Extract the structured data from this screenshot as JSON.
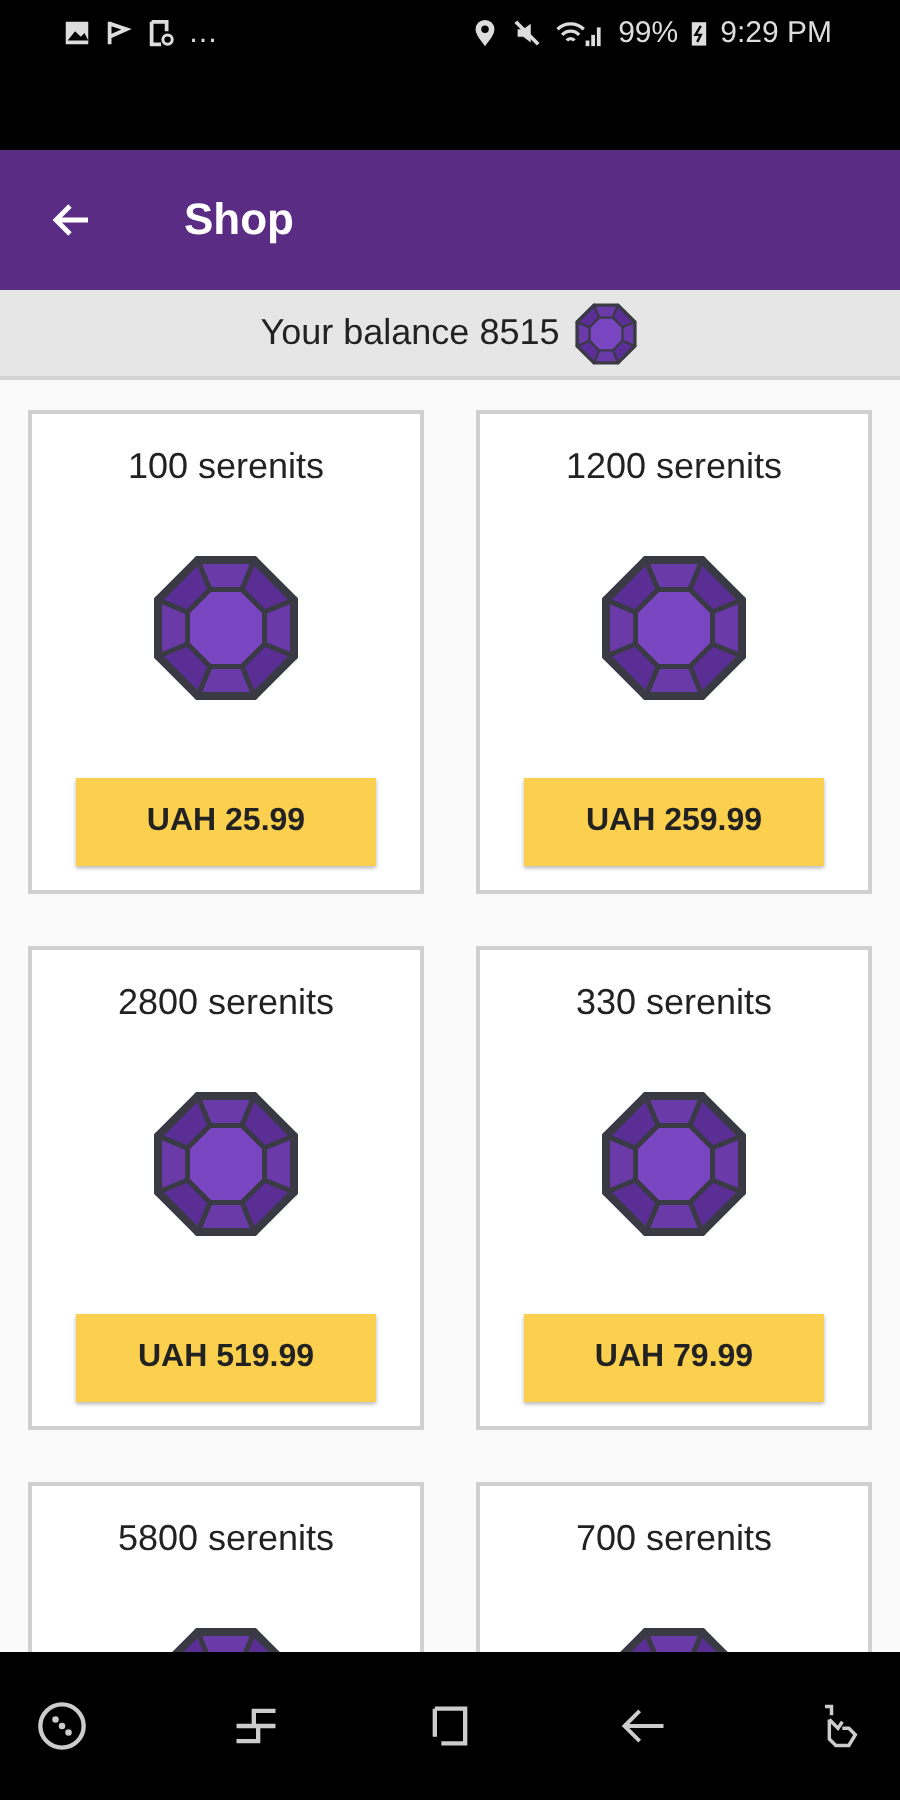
{
  "status_bar": {
    "overflow": "…",
    "battery": "99%",
    "time": "9:29 PM"
  },
  "app_bar": {
    "title": "Shop"
  },
  "balance": {
    "label": "Your balance 8515"
  },
  "packs": [
    {
      "amount": "100 serenits",
      "price": "UAH 25.99"
    },
    {
      "amount": "1200 serenits",
      "price": "UAH 259.99"
    },
    {
      "amount": "2800 serenits",
      "price": "UAH 519.99"
    },
    {
      "amount": "330 serenits",
      "price": "UAH 79.99"
    },
    {
      "amount": "5800 serenits"
    },
    {
      "amount": "700 serenits"
    }
  ]
}
